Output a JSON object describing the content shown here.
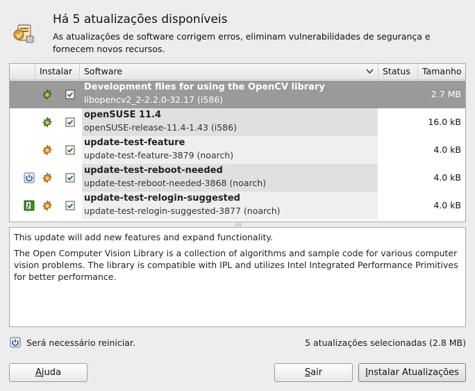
{
  "header": {
    "title": "Há 5 atualizações disponíveis",
    "subtitle": "As atualizações de software corrigem erros, eliminam vulnerabilidades de segurança e fornecem novos recursos."
  },
  "table": {
    "columns": {
      "install": "Instalar",
      "software": "Software",
      "status": "Status",
      "size": "Tamanho"
    },
    "rows": [
      {
        "name": "Development files for using the OpenCV library",
        "package": "libopencv2_2-2.2.0-32.17 (i586)",
        "size": "2.7 MB",
        "type": "recommended-icon",
        "extra": "",
        "checked": true,
        "selected": true
      },
      {
        "name": "openSUSE 11.4",
        "package": "openSUSE-release-11.4-1.43 (i586)",
        "size": "16.0 kB",
        "type": "recommended-icon",
        "extra": "",
        "checked": true,
        "selected": false
      },
      {
        "name": "update-test-feature",
        "package": "update-test-feature-3879 (noarch)",
        "size": "4.0 kB",
        "type": "feature-icon",
        "extra": "",
        "checked": true,
        "selected": false
      },
      {
        "name": "update-test-reboot-needed",
        "package": "update-test-reboot-needed-3868 (noarch)",
        "size": "4.0 kB",
        "type": "feature-icon",
        "extra": "restart-icon",
        "checked": true,
        "selected": false
      },
      {
        "name": "update-test-relogin-suggested",
        "package": "update-test-relogin-suggested-3877 (noarch)",
        "size": "4.0 kB",
        "type": "feature-icon",
        "extra": "logout-icon",
        "checked": true,
        "selected": false
      }
    ]
  },
  "description": {
    "line1": "This update will add new features and expand functionality.",
    "line2": "The Open Computer Vision Library is a collection of algorithms and sample code for various computer vision problems. The library is compatible with IPL and utilizes Intel Integrated Performance Primitives for better performance."
  },
  "footer": {
    "restart_notice": "Será necessário reiniciar.",
    "selected_summary": "5 atualizações selecionadas (2.8 MB)"
  },
  "buttons": {
    "help_u": "A",
    "help_rest": "juda",
    "quit_u": "S",
    "quit_rest": "air",
    "install_u": "I",
    "install_rest": "nstalar Atualizações"
  },
  "colors": {
    "selected_row": "#9a9a9a",
    "recommended": "#5c8c2a",
    "feature": "#e07d10"
  }
}
